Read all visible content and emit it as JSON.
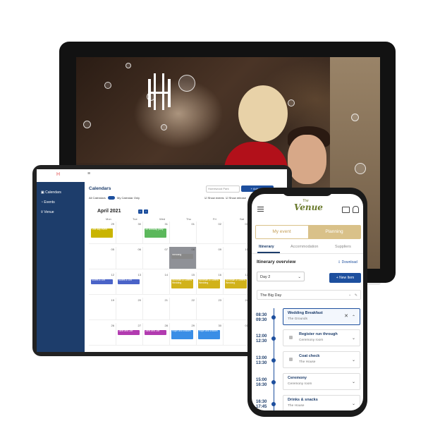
{
  "tablet": {
    "sidebar": [
      {
        "label": "Calendars"
      },
      {
        "label": "Events"
      },
      {
        "label": "Venue"
      }
    ],
    "title": "Calendars",
    "search_value": "Homewood Park",
    "add_button": "+ Add new",
    "all_calendars": "All Calendars",
    "my_calendar_only": "My Calendar Only",
    "show_events": "Show events",
    "show_releases": "Show release",
    "month": "April 2021",
    "days": [
      "Mon",
      "Tue",
      "Wed",
      "Thu",
      "Fri",
      "Sat"
    ],
    "rows": [
      [
        "29",
        "30",
        "31",
        "01",
        "02",
        "03"
      ],
      [
        "05",
        "06",
        "07",
        "08",
        "09",
        "10"
      ],
      [
        "12",
        "13",
        "14",
        "15",
        "16",
        "17"
      ],
      [
        "19",
        "20",
        "21",
        "22",
        "23",
        "24"
      ],
      [
        "26",
        "27",
        "28",
        "29",
        "30",
        "01"
      ]
    ],
    "events": {
      "e1": "One day event",
      "e2": "30 Birthday party",
      "e3": "Wedding",
      "e4": "Suites & Dirt",
      "e5": "Suites & Dirt",
      "e6": "Whitman & Owens Wedding",
      "e7": "Whitman & Owens Wedding",
      "e8": "Whitman & Owens Wedding",
      "e9": "Saturday",
      "e10": "Jane and Joe",
      "e11": "Jane and Joe",
      "e12": "Hope and William",
      "e13": "Hope and William"
    }
  },
  "phone": {
    "logo": "Venue",
    "logo_small": "The",
    "seg_a": "My event",
    "seg_b": "Planning",
    "tabs": [
      "Itinerary",
      "Accommodation",
      "Suppliers"
    ],
    "section_title": "Itinerary overview",
    "download": "Download",
    "day_select": "Day 2",
    "new_item": "+ New Item",
    "day_name": "The Big Day",
    "items": [
      {
        "start": "08:30",
        "end": "09:30",
        "title": "Wedding Breakfast",
        "sub": "The Grounds"
      },
      {
        "start": "12:00",
        "end": "12:30",
        "title": "Register run through",
        "sub": "Ceremony room"
      },
      {
        "start": "13:00",
        "end": "13:30",
        "title": "Coat check",
        "sub": "The House"
      },
      {
        "start": "15:00",
        "end": "16:30",
        "title": "Ceremony",
        "sub": "Ceremony room"
      },
      {
        "start": "16:30",
        "end": "17:45",
        "title": "Drinks & snacks",
        "sub": "The House"
      }
    ]
  }
}
